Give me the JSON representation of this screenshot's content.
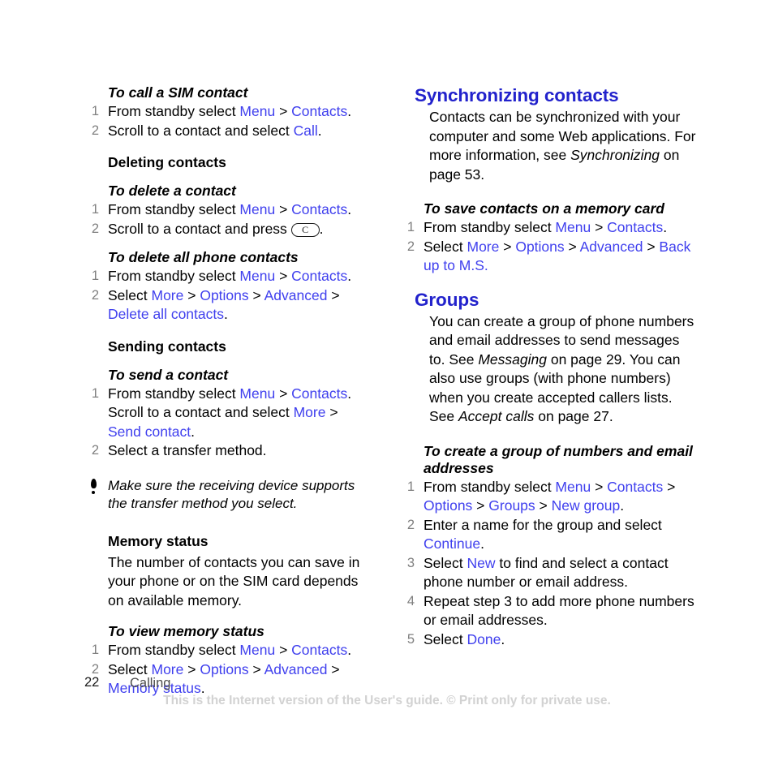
{
  "document": {
    "page_number": "22",
    "chapter": "Calling",
    "notice": "This is the Internet version of the User's guide. © Print only for private use.",
    "colors": {
      "heading_blue": "#2222cc",
      "link_blue": "#4040ee",
      "step_number_grey": "#808080",
      "notice_grey": "#d2d2d2",
      "body_black": "#000000"
    }
  },
  "left_column": {
    "task_call_sim": {
      "title": "To call a SIM contact",
      "steps": [
        {
          "num": "1",
          "parts": [
            {
              "t": "From standby select ",
              "s": "plain"
            },
            {
              "t": "Menu",
              "s": "link"
            },
            {
              "t": " > ",
              "s": "plain"
            },
            {
              "t": "Contacts",
              "s": "link"
            },
            {
              "t": ".",
              "s": "plain"
            }
          ]
        },
        {
          "num": "2",
          "parts": [
            {
              "t": "Scroll to a contact and select ",
              "s": "plain"
            },
            {
              "t": "Call",
              "s": "link"
            },
            {
              "t": ".",
              "s": "plain"
            }
          ]
        }
      ]
    },
    "heading_deleting": "Deleting contacts",
    "task_delete_contact": {
      "title": "To delete a contact",
      "steps": [
        {
          "num": "1",
          "parts": [
            {
              "t": "From standby select ",
              "s": "plain"
            },
            {
              "t": "Menu",
              "s": "link"
            },
            {
              "t": " > ",
              "s": "plain"
            },
            {
              "t": "Contacts",
              "s": "link"
            },
            {
              "t": ".",
              "s": "plain"
            }
          ]
        },
        {
          "num": "2",
          "parts": [
            {
              "t": "Scroll to a contact and press ",
              "s": "plain"
            },
            {
              "t": "C",
              "s": "key"
            },
            {
              "t": ".",
              "s": "plain"
            }
          ]
        }
      ]
    },
    "task_delete_all": {
      "title": "To delete all phone contacts",
      "steps": [
        {
          "num": "1",
          "parts": [
            {
              "t": "From standby select ",
              "s": "plain"
            },
            {
              "t": "Menu",
              "s": "link"
            },
            {
              "t": " > ",
              "s": "plain"
            },
            {
              "t": "Contacts",
              "s": "link"
            },
            {
              "t": ".",
              "s": "plain"
            }
          ]
        },
        {
          "num": "2",
          "parts": [
            {
              "t": "Select ",
              "s": "plain"
            },
            {
              "t": "More",
              "s": "link"
            },
            {
              "t": " > ",
              "s": "plain"
            },
            {
              "t": "Options",
              "s": "link"
            },
            {
              "t": " > ",
              "s": "plain"
            },
            {
              "t": "Advanced",
              "s": "link"
            },
            {
              "t": " > ",
              "s": "plain"
            },
            {
              "t": "Delete all contacts",
              "s": "link"
            },
            {
              "t": ".",
              "s": "plain"
            }
          ]
        }
      ]
    },
    "heading_sending": "Sending contacts",
    "task_send_contact": {
      "title": "To send a contact",
      "steps": [
        {
          "num": "1",
          "parts": [
            {
              "t": "From standby select ",
              "s": "plain"
            },
            {
              "t": "Menu",
              "s": "link"
            },
            {
              "t": " > ",
              "s": "plain"
            },
            {
              "t": "Contacts",
              "s": "link"
            },
            {
              "t": ". Scroll to a contact and select ",
              "s": "plain"
            },
            {
              "t": "More",
              "s": "link"
            },
            {
              "t": " > ",
              "s": "plain"
            },
            {
              "t": "Send contact",
              "s": "link"
            },
            {
              "t": ".",
              "s": "plain"
            }
          ]
        },
        {
          "num": "2",
          "parts": [
            {
              "t": "Select a transfer method.",
              "s": "plain"
            }
          ]
        }
      ]
    },
    "note": {
      "icon": "exclamation-icon",
      "text": "Make sure the receiving device supports the transfer method you select."
    },
    "heading_memory": "Memory status",
    "memory_paragraph": "The number of contacts you can save in your phone or on the SIM card depends on available memory.",
    "task_view_memory": {
      "title": "To view memory status",
      "steps": [
        {
          "num": "1",
          "parts": [
            {
              "t": "From standby select ",
              "s": "plain"
            },
            {
              "t": "Menu",
              "s": "link"
            },
            {
              "t": " > ",
              "s": "plain"
            },
            {
              "t": "Contacts",
              "s": "link"
            },
            {
              "t": ".",
              "s": "plain"
            }
          ]
        },
        {
          "num": "2",
          "parts": [
            {
              "t": "Select ",
              "s": "plain"
            },
            {
              "t": "More",
              "s": "link"
            },
            {
              "t": " > ",
              "s": "plain"
            },
            {
              "t": "Options",
              "s": "link"
            },
            {
              "t": " > ",
              "s": "plain"
            },
            {
              "t": "Advanced",
              "s": "link"
            },
            {
              "t": " > ",
              "s": "plain"
            },
            {
              "t": "Memory status",
              "s": "link"
            },
            {
              "t": ".",
              "s": "plain"
            }
          ]
        }
      ]
    }
  },
  "right_column": {
    "section_sync": {
      "title": "Synchronizing contacts",
      "paragraph_parts": [
        {
          "t": "Contacts can be synchronized with your computer and some Web applications. For more information, see ",
          "s": "plain"
        },
        {
          "t": "Synchronizing",
          "s": "em"
        },
        {
          "t": " on page 53.",
          "s": "plain"
        }
      ]
    },
    "task_save_memory_card": {
      "title": "To save contacts on a memory card",
      "steps": [
        {
          "num": "1",
          "parts": [
            {
              "t": "From standby select ",
              "s": "plain"
            },
            {
              "t": "Menu",
              "s": "link"
            },
            {
              "t": " > ",
              "s": "plain"
            },
            {
              "t": "Contacts",
              "s": "link"
            },
            {
              "t": ".",
              "s": "plain"
            }
          ]
        },
        {
          "num": "2",
          "parts": [
            {
              "t": "Select ",
              "s": "plain"
            },
            {
              "t": "More",
              "s": "link"
            },
            {
              "t": " > ",
              "s": "plain"
            },
            {
              "t": "Options",
              "s": "link"
            },
            {
              "t": " > ",
              "s": "plain"
            },
            {
              "t": "Advanced",
              "s": "link"
            },
            {
              "t": " > ",
              "s": "plain"
            },
            {
              "t": "Back up to M.S.",
              "s": "link"
            }
          ]
        }
      ]
    },
    "section_groups": {
      "title": "Groups",
      "paragraph_parts": [
        {
          "t": "You can create a group of phone numbers and email addresses to send messages to. See ",
          "s": "plain"
        },
        {
          "t": "Messaging",
          "s": "em"
        },
        {
          "t": " on page 29. You can also use groups (with phone numbers) when you create accepted callers lists. See ",
          "s": "plain"
        },
        {
          "t": "Accept calls",
          "s": "em"
        },
        {
          "t": " on page 27.",
          "s": "plain"
        }
      ]
    },
    "task_create_group": {
      "title": "To create a group of numbers and email addresses",
      "steps": [
        {
          "num": "1",
          "parts": [
            {
              "t": "From standby select ",
              "s": "plain"
            },
            {
              "t": "Menu",
              "s": "link"
            },
            {
              "t": " > ",
              "s": "plain"
            },
            {
              "t": "Contacts",
              "s": "link"
            },
            {
              "t": " > ",
              "s": "plain"
            },
            {
              "t": "Options",
              "s": "link"
            },
            {
              "t": " > ",
              "s": "plain"
            },
            {
              "t": "Groups",
              "s": "link"
            },
            {
              "t": " > ",
              "s": "plain"
            },
            {
              "t": "New group",
              "s": "link"
            },
            {
              "t": ".",
              "s": "plain"
            }
          ]
        },
        {
          "num": "2",
          "parts": [
            {
              "t": "Enter a name for the group and select ",
              "s": "plain"
            },
            {
              "t": "Continue",
              "s": "link"
            },
            {
              "t": ".",
              "s": "plain"
            }
          ]
        },
        {
          "num": "3",
          "parts": [
            {
              "t": "Select ",
              "s": "plain"
            },
            {
              "t": "New",
              "s": "link"
            },
            {
              "t": " to find and select a contact phone number or email address.",
              "s": "plain"
            }
          ]
        },
        {
          "num": "4",
          "parts": [
            {
              "t": "Repeat step 3 to add more phone numbers or email addresses.",
              "s": "plain"
            }
          ]
        },
        {
          "num": "5",
          "parts": [
            {
              "t": "Select ",
              "s": "plain"
            },
            {
              "t": "Done",
              "s": "link"
            },
            {
              "t": ".",
              "s": "plain"
            }
          ]
        }
      ]
    }
  }
}
